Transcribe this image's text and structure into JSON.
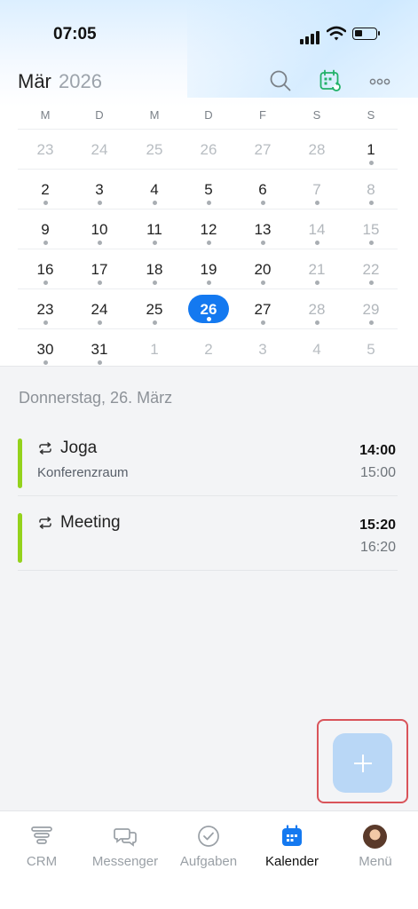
{
  "status_bar": {
    "time": "07:05"
  },
  "header": {
    "month": "Mär",
    "year": "2026"
  },
  "weekdays": [
    "M",
    "D",
    "M",
    "D",
    "F",
    "S",
    "S"
  ],
  "calendar_rows": [
    [
      {
        "d": "23",
        "muted": true
      },
      {
        "d": "24",
        "muted": true
      },
      {
        "d": "25",
        "muted": true
      },
      {
        "d": "26",
        "muted": true
      },
      {
        "d": "27",
        "muted": true
      },
      {
        "d": "28",
        "muted": true
      },
      {
        "d": "1",
        "dot": true
      }
    ],
    [
      {
        "d": "2",
        "dot": true
      },
      {
        "d": "3",
        "dot": true
      },
      {
        "d": "4",
        "dot": true
      },
      {
        "d": "5",
        "dot": true
      },
      {
        "d": "6",
        "dot": true
      },
      {
        "d": "7",
        "we": true,
        "dot": true
      },
      {
        "d": "8",
        "we": true,
        "dot": true
      }
    ],
    [
      {
        "d": "9",
        "dot": true
      },
      {
        "d": "10",
        "dot": true
      },
      {
        "d": "11",
        "dot": true
      },
      {
        "d": "12",
        "dot": true
      },
      {
        "d": "13",
        "dot": true
      },
      {
        "d": "14",
        "we": true,
        "dot": true
      },
      {
        "d": "15",
        "we": true,
        "dot": true
      }
    ],
    [
      {
        "d": "16",
        "dot": true
      },
      {
        "d": "17",
        "dot": true
      },
      {
        "d": "18",
        "dot": true
      },
      {
        "d": "19",
        "dot": true
      },
      {
        "d": "20",
        "dot": true
      },
      {
        "d": "21",
        "we": true,
        "dot": true
      },
      {
        "d": "22",
        "we": true,
        "dot": true
      }
    ],
    [
      {
        "d": "23",
        "dot": true
      },
      {
        "d": "24",
        "dot": true
      },
      {
        "d": "25",
        "dot": true
      },
      {
        "d": "26",
        "dot": true,
        "selected": true
      },
      {
        "d": "27",
        "dot": true
      },
      {
        "d": "28",
        "we": true,
        "dot": true
      },
      {
        "d": "29",
        "we": true,
        "dot": true
      }
    ],
    [
      {
        "d": "30",
        "dot": true
      },
      {
        "d": "31",
        "dot": true
      },
      {
        "d": "1",
        "muted": true
      },
      {
        "d": "2",
        "muted": true
      },
      {
        "d": "3",
        "muted": true
      },
      {
        "d": "4",
        "muted": true
      },
      {
        "d": "5",
        "muted": true
      }
    ]
  ],
  "agenda": {
    "date_heading": "Donnerstag, 26. März",
    "events": [
      {
        "title": "Joga",
        "location": "Konferenzraum",
        "start": "14:00",
        "end": "15:00",
        "color": "#94d21c"
      },
      {
        "title": "Meeting",
        "location": "",
        "start": "15:20",
        "end": "16:20",
        "color": "#94d21c"
      }
    ]
  },
  "fab": {
    "icon": "plus-icon"
  },
  "tabbar": {
    "items": [
      {
        "label": "CRM",
        "icon": "crm-funnel-icon"
      },
      {
        "label": "Messenger",
        "icon": "chat-bubbles-icon"
      },
      {
        "label": "Aufgaben",
        "icon": "check-circle-icon"
      },
      {
        "label": "Kalender",
        "icon": "calendar-icon",
        "active": true
      },
      {
        "label": "Menü",
        "icon": "avatar"
      }
    ]
  },
  "colors": {
    "accent": "#1479f0",
    "event_bar": "#94d21c",
    "highlight_frame": "#d9545a",
    "fab": "#b9d7f6"
  }
}
